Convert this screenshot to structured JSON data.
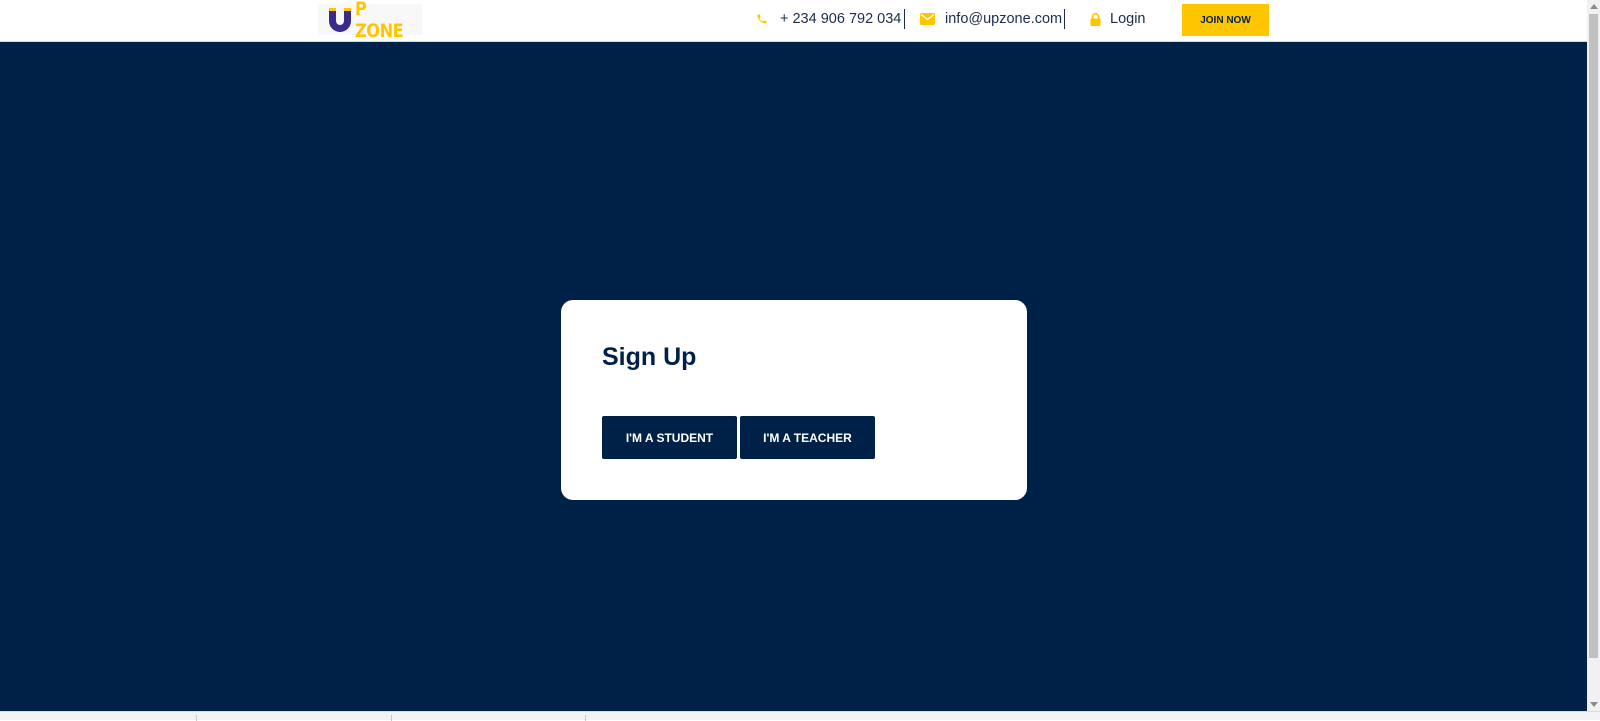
{
  "header": {
    "logo_text": "P ZONE",
    "phone": "+ 234 906 792 034",
    "email": "info@upzone.com",
    "login_label": "Login",
    "join_label": "JOIN NOW",
    "icons": {
      "logo": "u-magnet-logo",
      "phone": "phone-icon",
      "email": "envelope-icon",
      "login": "lock-icon"
    }
  },
  "signup": {
    "title": "Sign Up",
    "student_label": "I'M A STUDENT",
    "teacher_label": "I'M A TEACHER"
  },
  "colors": {
    "navy": "#002147",
    "accent_yellow": "#ffc600",
    "logo_purple": "#3a2a8c",
    "white": "#ffffff"
  }
}
